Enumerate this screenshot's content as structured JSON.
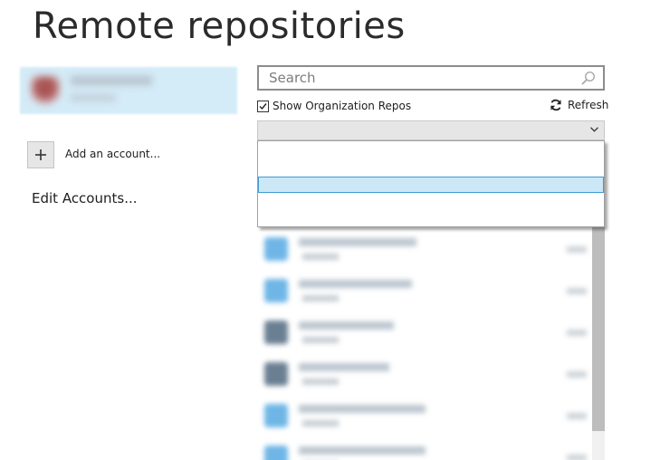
{
  "page": {
    "title": "Remote repositories"
  },
  "accounts": {
    "add_label": "Add an account...",
    "edit_label": "Edit Accounts..."
  },
  "search": {
    "placeholder": "Search",
    "value": ""
  },
  "filters": {
    "show_org_repos_label": "Show Organization Repos",
    "show_org_repos_checked": true,
    "refresh_label": "Refresh"
  },
  "owner_select": {
    "selected": "",
    "options": [
      "",
      "",
      ""
    ],
    "highlighted_index": 1
  },
  "icons": {
    "search": "search-icon",
    "refresh": "refresh-icon",
    "add": "plus-icon",
    "dropdown": "chevron-down-icon",
    "check": "checkmark-icon"
  },
  "colors": {
    "selection_bg": "#cce8f6",
    "selection_border": "#3c9bd6",
    "account_card_bg": "#d4ecf8"
  }
}
